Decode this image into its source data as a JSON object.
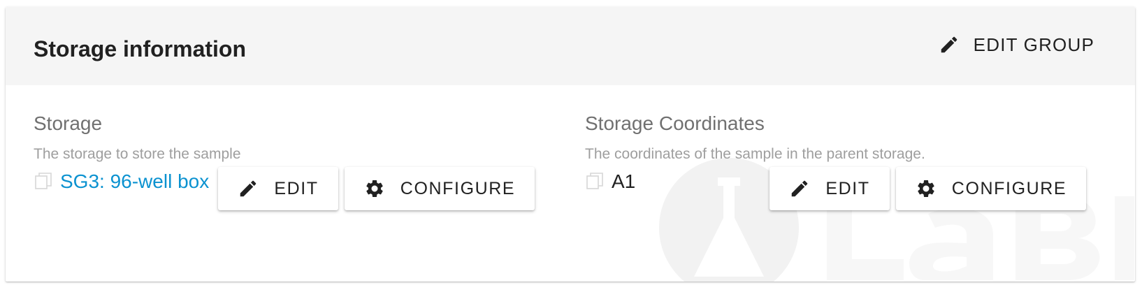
{
  "section": {
    "title": "Storage information",
    "edit_group_label": "EDIT GROUP"
  },
  "fields": {
    "storage": {
      "label": "Storage",
      "help": "The storage to store the sample",
      "value": "SG3: 96-well box",
      "edit_label": "EDIT",
      "configure_label": "CONFIGURE"
    },
    "coordinates": {
      "label": "Storage Coordinates",
      "help": "The coordinates of the sample in the parent storage.",
      "value": "A1",
      "edit_label": "EDIT",
      "configure_label": "CONFIGURE"
    }
  },
  "icons": {
    "edit": "pencil-icon",
    "configure": "gear-icon",
    "copy": "copy-icon",
    "watermark": "logo-watermark"
  },
  "colors": {
    "link": "#0b92d0",
    "header_bg": "#f5f5f5",
    "text": "#212121",
    "label": "#707070",
    "help": "#9e9e9e"
  }
}
